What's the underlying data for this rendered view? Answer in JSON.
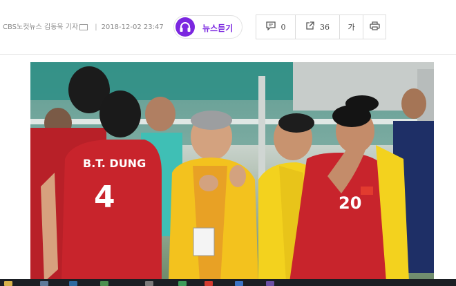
{
  "article": {
    "byline": "CBS노컷뉴스 김동욱 기자",
    "separator": "|",
    "timestamp": "2018-12-02 23:47"
  },
  "listen_button": {
    "label": "뉴스듣기",
    "icon": "headphones-icon"
  },
  "toolbar": {
    "comment_icon": "comment-icon",
    "comment_count": "0",
    "share_icon": "share-icon",
    "share_count": "36",
    "font_label": "가",
    "print_icon": "print-icon"
  },
  "photo": {
    "jersey_name": "B.T. DUNG",
    "jersey_number": "4",
    "jersey_number_right": "20"
  },
  "colors": {
    "accent_purple": "#7b27e0",
    "jersey_red": "#c8242c",
    "staff_yellow": "#f3d21e",
    "taskbar": "#1b1f24"
  }
}
